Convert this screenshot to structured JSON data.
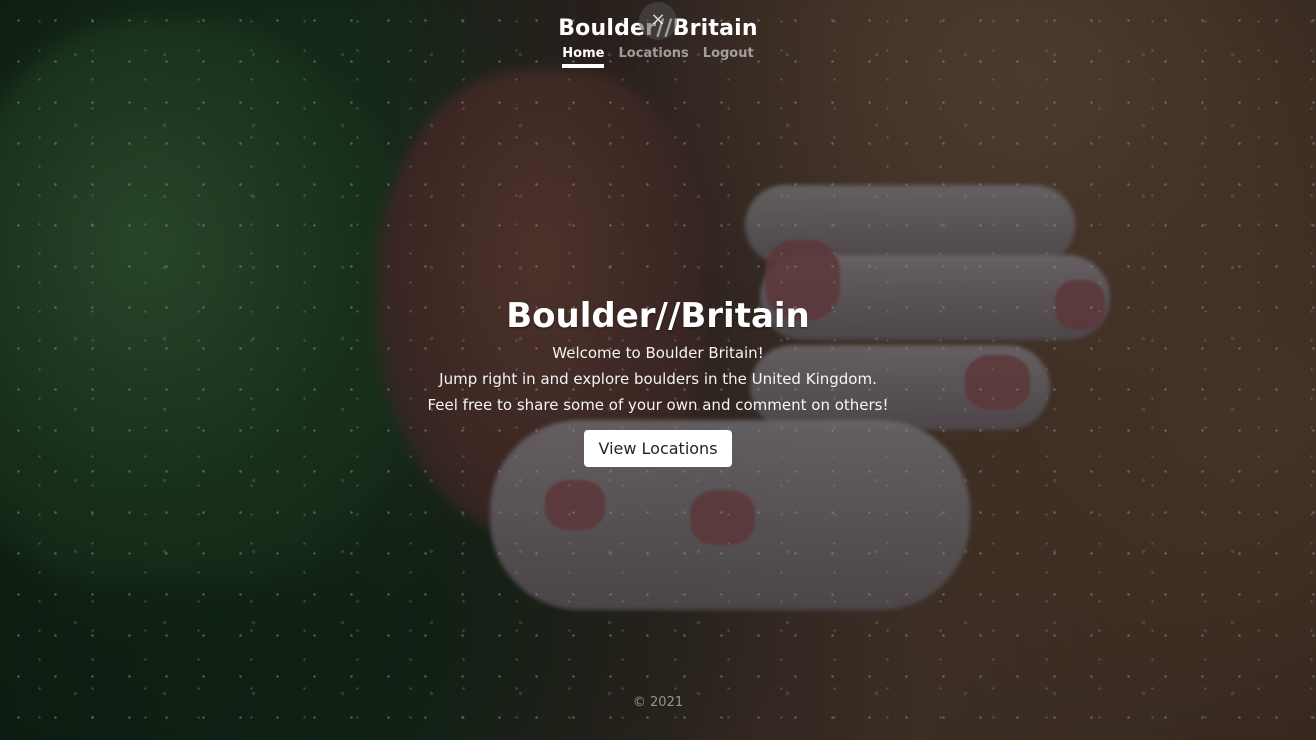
{
  "header": {
    "brand": "Boulder//Britain",
    "nav": [
      {
        "label": "Home",
        "active": true
      },
      {
        "label": "Locations",
        "active": false
      },
      {
        "label": "Logout",
        "active": false
      }
    ],
    "close_icon": "×"
  },
  "hero": {
    "title": "Boulder//Britain",
    "lines": [
      "Welcome to Boulder Britain!",
      "Jump right in and explore boulders in the United Kingdom.",
      "Feel free to share some of your own and comment on others!"
    ],
    "cta_label": "View Locations"
  },
  "footer": {
    "copyright": "© 2021"
  },
  "colors": {
    "text": "#ffffff",
    "button_bg": "#ffffff",
    "button_text": "#212529"
  }
}
